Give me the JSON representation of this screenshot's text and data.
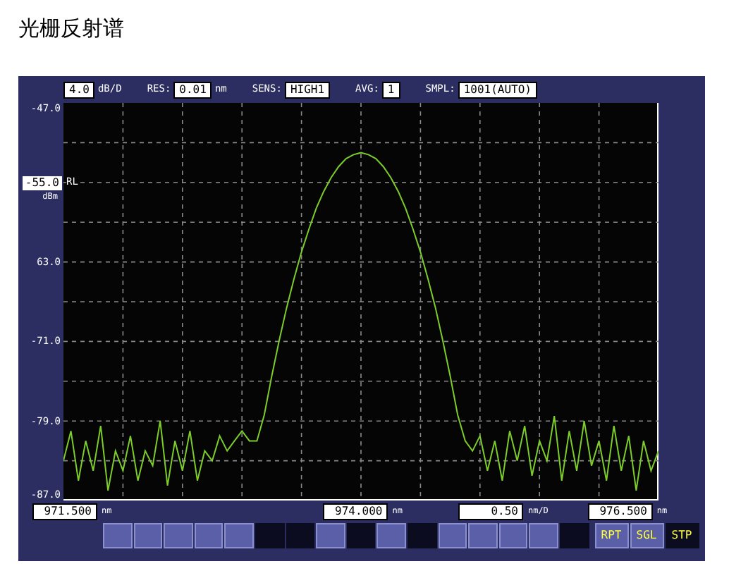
{
  "page_title": "光栅反射谱",
  "top_bar": [
    {
      "value": "4.0",
      "unit": "dB/D"
    },
    {
      "label": "RES:",
      "value": "0.01",
      "unit": "nm"
    },
    {
      "label": "SENS:",
      "value": "HIGH1"
    },
    {
      "label": "AVG:",
      "value": "1"
    },
    {
      "label": "SMPL:",
      "value": "1001(AUTO)"
    }
  ],
  "display": {
    "chart_data": {
      "type": "line",
      "grid": true,
      "ylim": [
        -87,
        -47
      ],
      "yticks": [
        {
          "value": -47,
          "label": "-47.0"
        },
        {
          "value": -63,
          "label": "63.0"
        },
        {
          "value": -71,
          "label": "-71.0"
        },
        {
          "value": -79,
          "label": "-79.0"
        },
        {
          "value": -87,
          "label": "-87.0"
        }
      ],
      "categories": [
        null,
        null,
        null,
        null,
        null,
        null,
        null,
        null,
        null,
        null,
        null,
        null,
        null,
        null,
        null,
        null,
        null,
        null,
        null,
        null,
        null,
        null,
        null,
        null,
        null,
        null,
        null,
        null,
        null,
        null,
        null,
        null,
        null,
        null,
        null,
        null,
        null,
        null,
        null,
        null,
        null,
        null,
        null,
        null,
        null,
        null,
        null,
        null,
        null,
        null,
        null,
        null,
        null,
        null,
        null,
        null,
        null,
        null,
        null,
        null,
        null,
        null,
        null,
        null,
        null,
        null,
        null,
        null,
        null,
        null,
        null,
        null,
        null,
        null,
        null,
        null,
        null,
        null,
        null,
        null,
        null
      ],
      "series": [
        {
          "color": "#7ccc2a",
          "values": [
            -83,
            -80,
            -85,
            -81,
            -84,
            -79.5,
            -86,
            -82,
            -84,
            -80.5,
            -85,
            -82,
            -83.5,
            -79,
            -85.5,
            -81,
            -84,
            -80,
            -85,
            -82,
            -83,
            -80.5,
            -82,
            -81,
            -80,
            -81,
            -81,
            -78.4,
            -74.5,
            -70.9,
            -67.6,
            -64.7,
            -62,
            -59.7,
            -57.6,
            -55.9,
            -54.5,
            -53.4,
            -52.6,
            -52.2,
            -52,
            -52.2,
            -52.6,
            -53.4,
            -54.5,
            -55.9,
            -57.6,
            -59.7,
            -62,
            -64.7,
            -67.6,
            -70.9,
            -74.5,
            -78.4,
            -81,
            -82,
            -80.5,
            -84,
            -81,
            -85,
            -80,
            -83,
            -79.5,
            -84.5,
            -81,
            -83,
            -78.5,
            -85,
            -80,
            -84,
            -79,
            -83.5,
            -81,
            -85,
            -79.5,
            -84,
            -80.5,
            -86,
            -81,
            -84,
            -82
          ]
        }
      ]
    }
  },
  "ref_level": {
    "value": "-55.0",
    "unit": "dBm",
    "marker": "RL"
  },
  "readouts": [
    {
      "value": "971.500",
      "unit": "nm"
    },
    {
      "value": "974.000",
      "unit": "nm"
    },
    {
      "value": "0.50",
      "unit": "nm/D"
    },
    {
      "value": "976.500",
      "unit": "nm"
    }
  ],
  "soft_keys": [
    {
      "selected": false
    },
    {
      "selected": false
    },
    {
      "selected": false
    },
    {
      "selected": false
    },
    {
      "selected": false
    },
    {
      "selected": true
    },
    {
      "selected": true
    },
    {
      "selected": false
    },
    {
      "selected": true
    },
    {
      "selected": false
    },
    {
      "selected": true
    },
    {
      "selected": false
    },
    {
      "selected": false
    },
    {
      "selected": false
    },
    {
      "selected": false
    },
    {
      "selected": true
    }
  ],
  "sweep_buttons": [
    {
      "label": "RPT",
      "selected": false
    },
    {
      "label": "SGL",
      "selected": false
    },
    {
      "label": "STP",
      "selected": true
    }
  ]
}
